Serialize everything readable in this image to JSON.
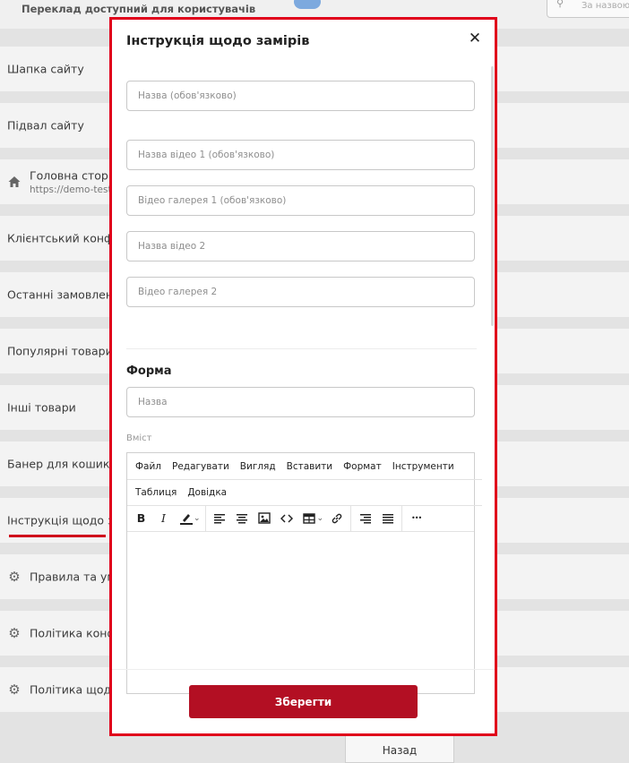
{
  "background": {
    "translation_label": "Переклад доступний для користувачів",
    "search_placeholder": "За назвою",
    "rows": [
      {
        "label": "Шапка сайту"
      },
      {
        "label": "Підвал сайту"
      },
      {
        "label": "Головна сторінк",
        "sub": "https://demo-test."
      },
      {
        "label": "Клієнтський конфігу"
      },
      {
        "label": "Останні замовлення"
      },
      {
        "label": "Популярні товари"
      },
      {
        "label": "Інші товари"
      },
      {
        "label": "Банер для кошика"
      },
      {
        "label": "Інструкція щодо зам"
      },
      {
        "label": "Правила та умо"
      },
      {
        "label": "Політика конфід"
      },
      {
        "label": "Політика щодо с"
      }
    ],
    "back_label": "Назад"
  },
  "modal": {
    "title": "Інструкція щодо замірів",
    "fields": {
      "name": {
        "placeholder": "Назва (обов'язково)",
        "value": ""
      },
      "video_name_1": {
        "placeholder": "Назва відео 1 (обов'язково)",
        "value": ""
      },
      "video_gallery_1": {
        "placeholder": "Відео галерея 1 (обов'язково)",
        "value": ""
      },
      "video_name_2": {
        "placeholder": "Назва відео 2",
        "value": ""
      },
      "video_gallery_2": {
        "placeholder": "Відео галерея 2",
        "value": ""
      }
    },
    "form_section": {
      "title": "Форма",
      "name_placeholder": "Назва",
      "content_label": "Вміст"
    },
    "editor": {
      "menu_row1": [
        "Файл",
        "Редагувати",
        "Вигляд",
        "Вставити",
        "Формат",
        "Інструменти"
      ],
      "menu_row2": [
        "Таблиця",
        "Довідка"
      ],
      "toolbar_icons": [
        "bold-icon",
        "italic-icon",
        "highlight-icon",
        "align-left-icon",
        "align-center-icon",
        "image-icon",
        "code-icon",
        "table-icon",
        "link-icon",
        "align-right-icon",
        "justify-icon",
        "more-icon"
      ],
      "toolbar_glyphs": {
        "bold": "B",
        "italic": "I",
        "more": "•••"
      }
    },
    "save_label": "Зберегти",
    "colors": {
      "primary": "#b30f23",
      "highlight_frame": "#e0001b"
    }
  }
}
